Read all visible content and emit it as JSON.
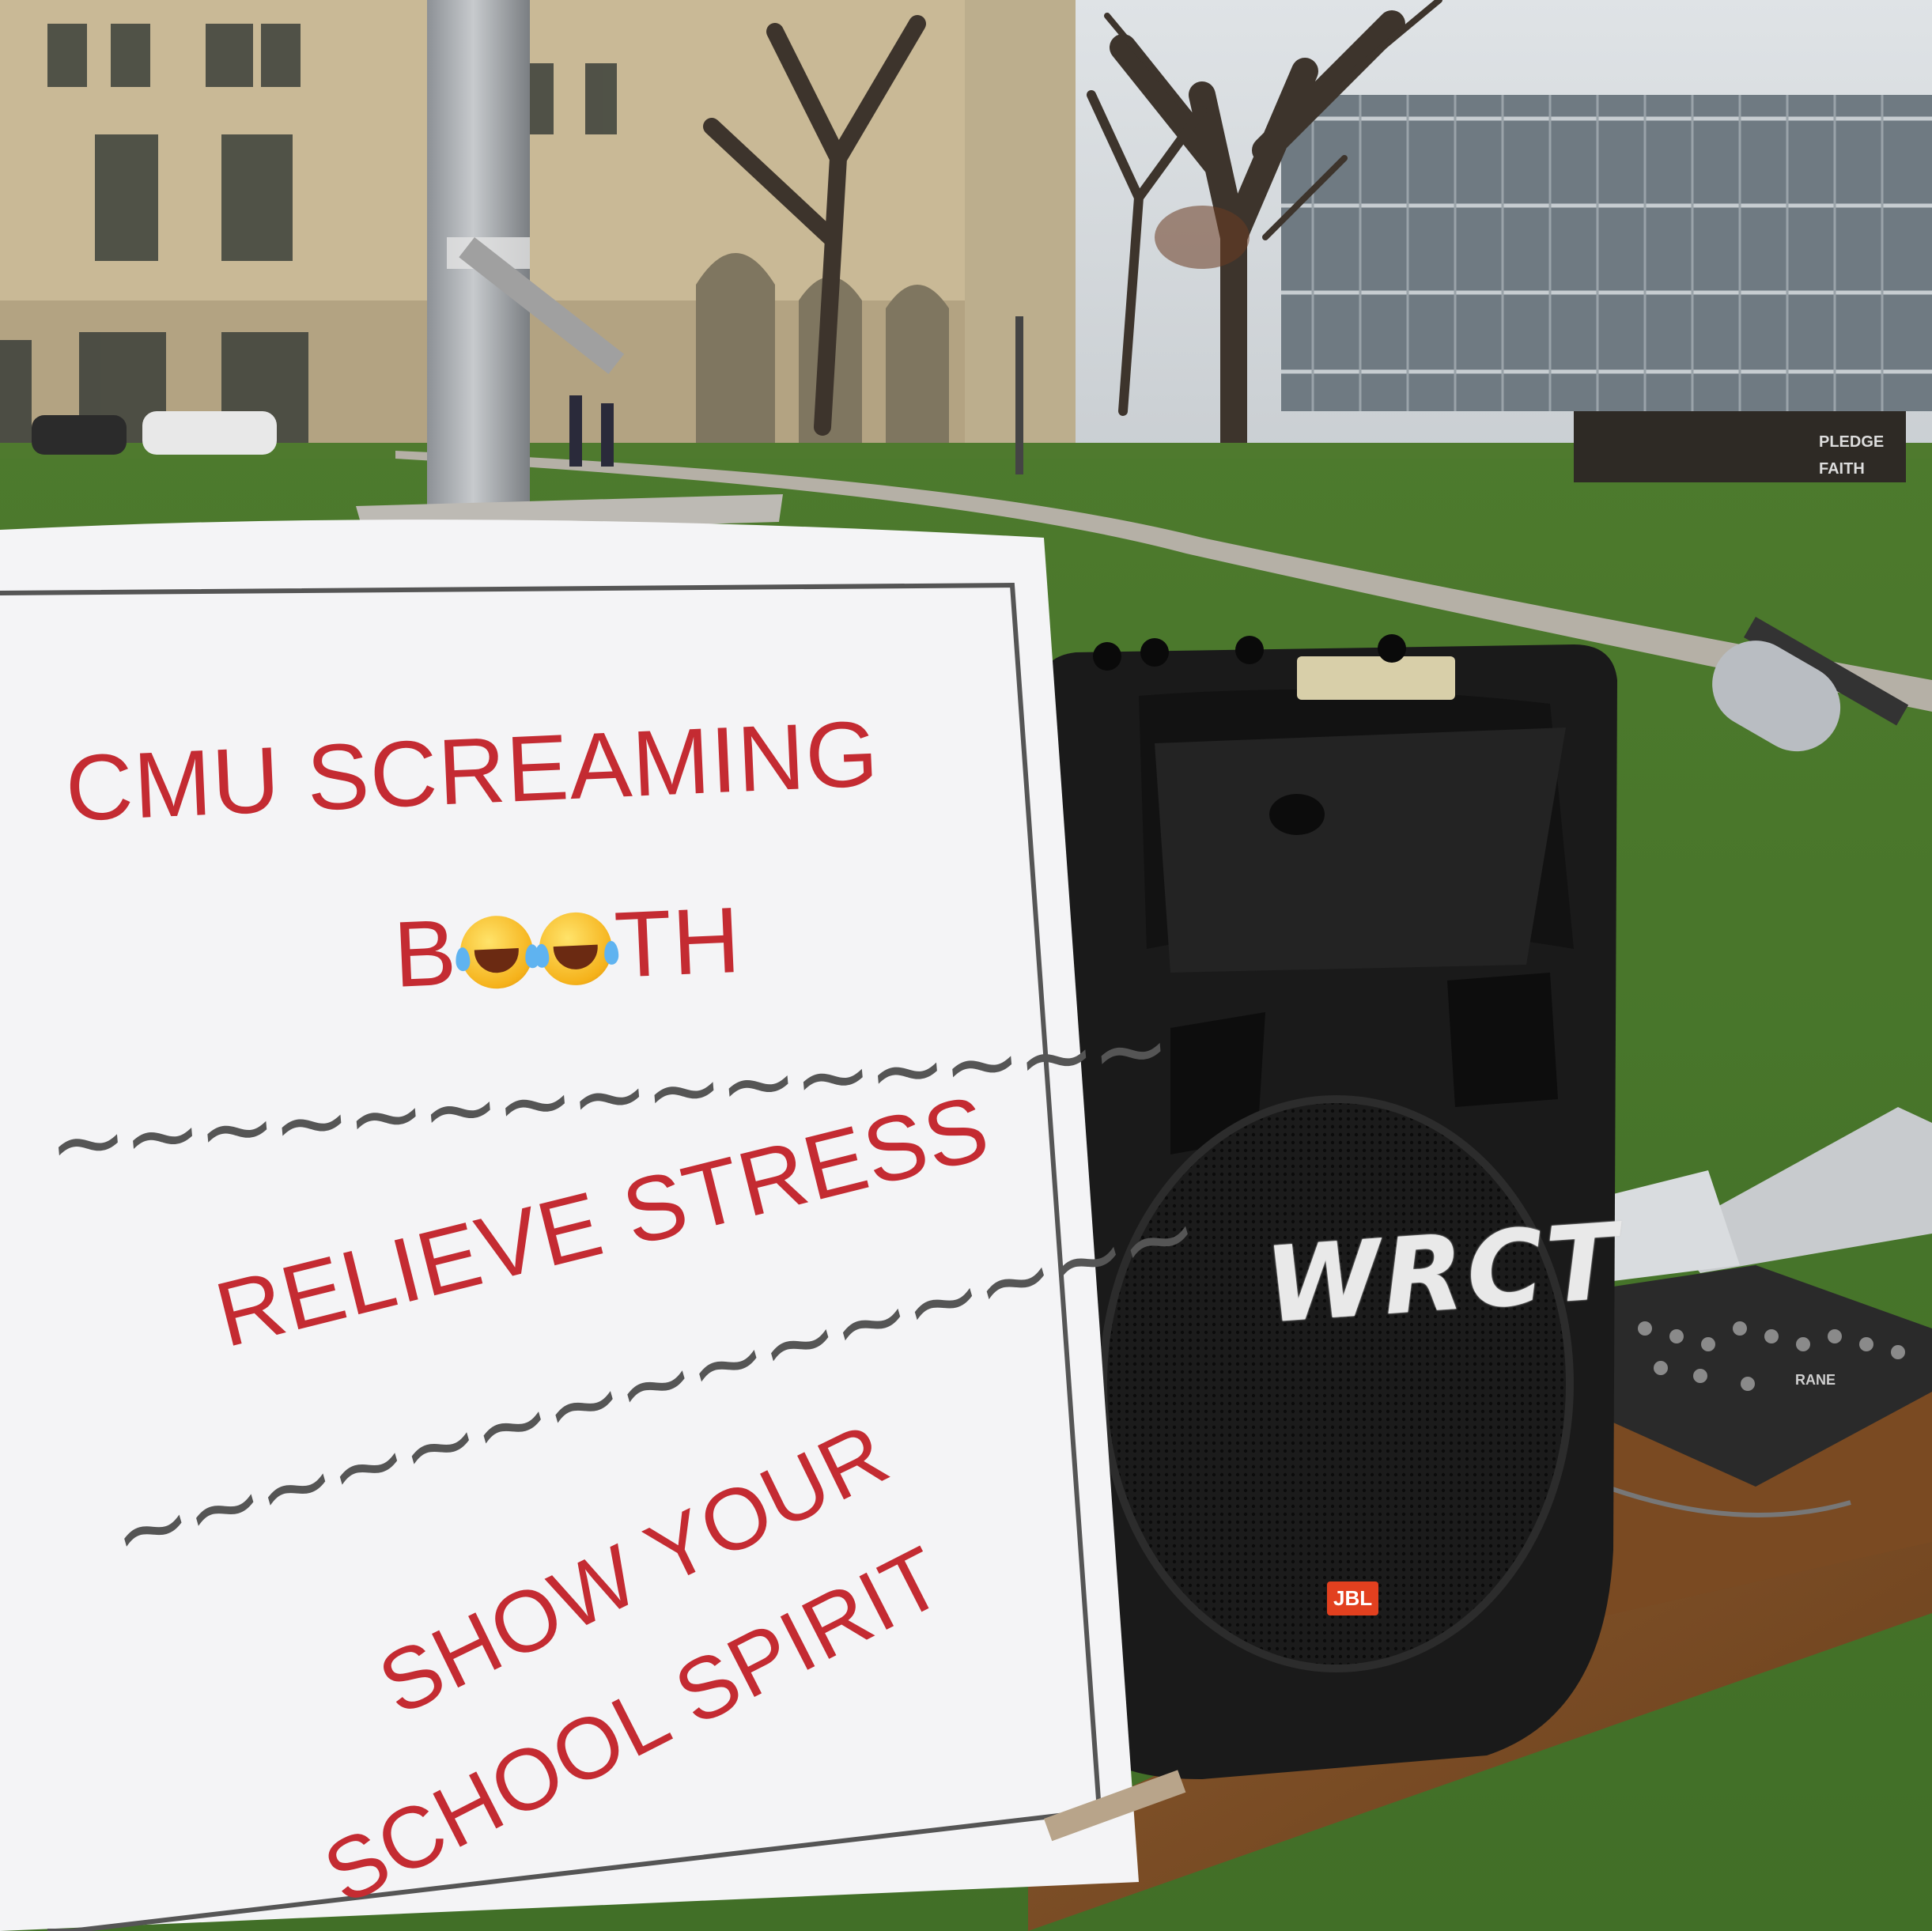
{
  "sign": {
    "line1": "CMU SCREAMING",
    "line2_left": "B",
    "line2_right": "TH",
    "divider1": "~~~~~~~~~~~~~~~",
    "line3": "RELIEVE STRESS",
    "divider2": "~~~~~~~~~~~~~~~",
    "line4": "SHOW YOUR",
    "line5": "SCHOOL SPIRIT",
    "text_color": "#c42b32",
    "emoji": "face-with-tears-of-joy-icon"
  },
  "speaker": {
    "logo": "WRCT",
    "brand": "JBL"
  },
  "mixer": {
    "brand": "RANE"
  },
  "background_sign": {
    "line1": "PLEDGE",
    "line2": "FAITH"
  }
}
